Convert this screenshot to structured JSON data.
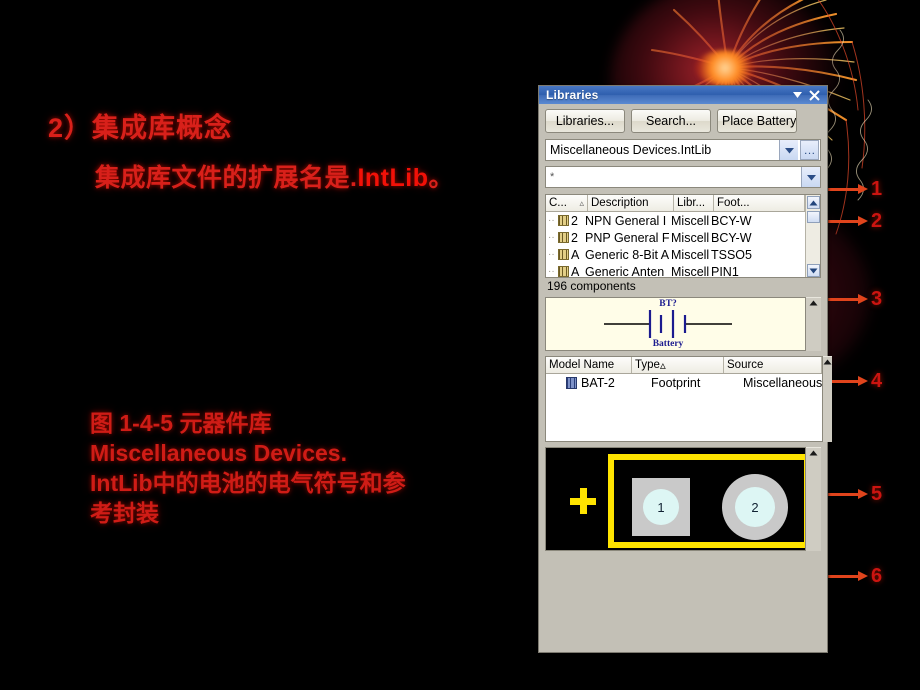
{
  "slide": {
    "heading_number": "2）",
    "heading_text": "集成库概念",
    "subheading_prefix": "集成库文件的扩展名是.",
    "subheading_ext": "IntLib",
    "subheading_suffix": "。",
    "caption": "图 1-4-5 元器件库 Miscellaneous Devices. IntLib中的电池的电气符号和参考封装",
    "text_color": "#d8201a",
    "background_color": "#000000"
  },
  "callouts": [
    {
      "number": "1"
    },
    {
      "number": "2"
    },
    {
      "number": "3"
    },
    {
      "number": "4"
    },
    {
      "number": "5"
    },
    {
      "number": "6"
    }
  ],
  "panel": {
    "title": "Libraries",
    "titlebar_color": "#2e5fae",
    "minimize_icon": "chevron-down-icon",
    "close_icon": "close-icon",
    "buttons": [
      {
        "label": "Libraries...",
        "name": "libraries-button"
      },
      {
        "label": "Search...",
        "name": "search-button"
      },
      {
        "label": "Place Battery",
        "name": "place-battery-button"
      }
    ],
    "library_select": {
      "value": "Miscellaneous Devices.IntLib",
      "dropdown_icon": "chevron-down-icon",
      "more_label": "…"
    },
    "filter": {
      "value": "*",
      "placeholder": "*",
      "dropdown_icon": "chevron-down-icon"
    },
    "component_list": {
      "columns": [
        "C...",
        "Description",
        "Libr...",
        "Foot..."
      ],
      "sort_indicator": "▵",
      "rows": [
        {
          "name": "2",
          "description": "NPN General I",
          "library": "Miscell",
          "footprint": "BCY-W"
        },
        {
          "name": "2",
          "description": "PNP General F",
          "library": "Miscell",
          "footprint": "BCY-W"
        },
        {
          "name": "A",
          "description": "Generic 8-Bit A",
          "library": "Miscell",
          "footprint": "TSSO5"
        },
        {
          "name": "A",
          "description": "Generic Anten",
          "library": "Miscell",
          "footprint": "PIN1"
        }
      ],
      "count_label": "196 components"
    },
    "symbol_preview": {
      "designator": "BT?",
      "name": "Battery",
      "symbol": "battery-symbol"
    },
    "model_table": {
      "columns": [
        "Model Name",
        "Type",
        "Source"
      ],
      "sort_indicator": "▵",
      "rows": [
        {
          "model_name": "BAT-2",
          "type": "Footprint",
          "source": "Miscellaneous"
        }
      ]
    },
    "footprint_preview": {
      "pads": [
        {
          "label": "1",
          "shape": "square"
        },
        {
          "label": "2",
          "shape": "round"
        }
      ],
      "outline_color": "#ffe400",
      "origin_icon": "origin-crosshair-icon"
    },
    "collapse_icon": "chevron-up-icon",
    "scroll_up_icon": "chevron-up-icon",
    "scroll_down_icon": "chevron-down-icon"
  }
}
